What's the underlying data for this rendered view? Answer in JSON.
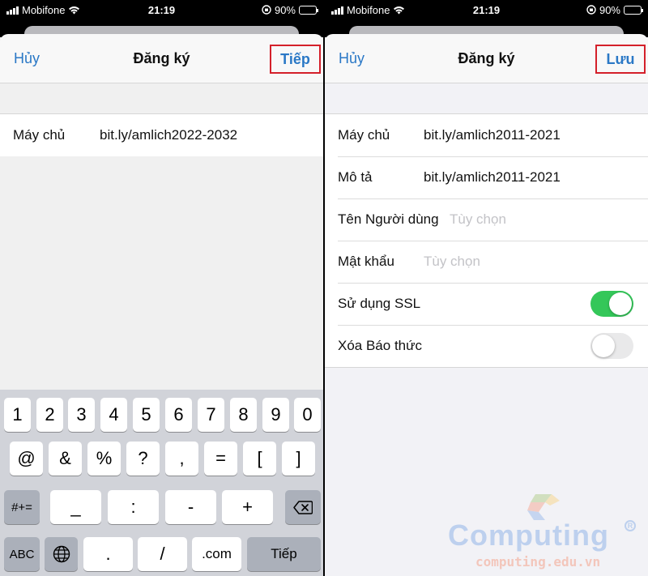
{
  "status": {
    "carrier": "Mobifone",
    "time": "21:19",
    "battery": "90%",
    "battery_level": 0.9
  },
  "left": {
    "nav": {
      "cancel": "Hủy",
      "title": "Đăng ký",
      "next": "Tiếp"
    },
    "rows": [
      {
        "label": "Máy chủ",
        "value": "bit.ly/amlich2022-2032"
      }
    ],
    "keyboard": {
      "row1": [
        "1",
        "2",
        "3",
        "4",
        "5",
        "6",
        "7",
        "8",
        "9",
        "0"
      ],
      "row2": [
        "@",
        "&",
        "%",
        "?",
        ",",
        "=",
        "[",
        "]"
      ],
      "row3": {
        "shift": "#+=",
        "keys": [
          "_",
          ":",
          "-",
          "+"
        ],
        "delete_icon": "backspace-icon"
      },
      "row4": {
        "abc": "ABC",
        "globe_icon": "globe-icon",
        "keys": [
          ".",
          "/",
          ".com"
        ],
        "return": "Tiếp"
      }
    }
  },
  "right": {
    "nav": {
      "cancel": "Hủy",
      "title": "Đăng ký",
      "save": "Lưu"
    },
    "rows": [
      {
        "label": "Máy chủ",
        "value": "bit.ly/amlich2011-2021"
      },
      {
        "label": "Mô tả",
        "value": "bit.ly/amlich2011-2021"
      },
      {
        "label": "Tên Người dùng",
        "placeholder": "Tùy chọn"
      },
      {
        "label": "Mật khẩu",
        "placeholder": "Tùy chọn"
      }
    ],
    "toggles": [
      {
        "label": "Sử dụng SSL",
        "on": true
      },
      {
        "label": "Xóa Báo thức",
        "on": false
      }
    ]
  },
  "watermark": {
    "brand": "Computing",
    "url": "computing.edu.vn"
  },
  "colors": {
    "accent": "#2a78c6",
    "highlight_box": "#d4202a",
    "toggle_on": "#34c759"
  }
}
